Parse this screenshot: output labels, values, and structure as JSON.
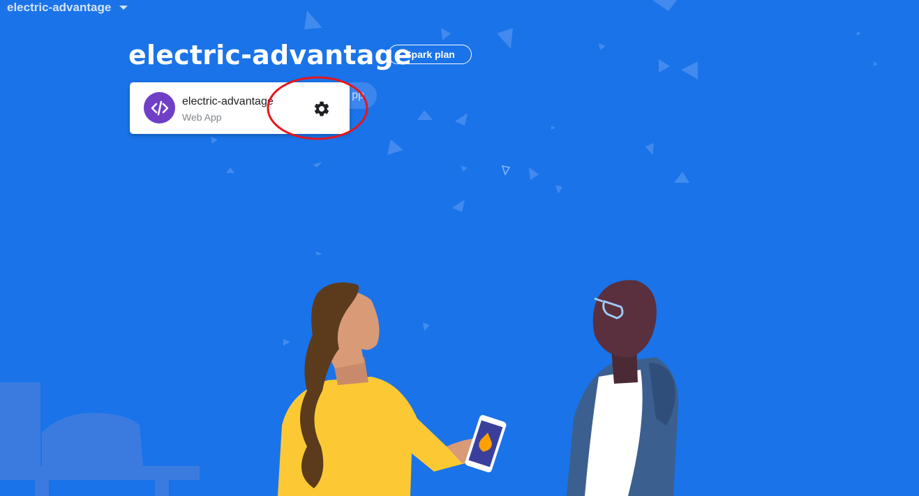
{
  "header": {
    "project_switcher_label": "electric-advantage",
    "project_title": "electric-advantage",
    "plan_badge": "Spark plan",
    "add_app_partial": "pp"
  },
  "apps": [
    {
      "name": "electric-advantage",
      "type": "Web App",
      "icon": "code-brackets-icon"
    }
  ],
  "colors": {
    "background": "#1a73e8",
    "app_icon_bg": "#6f3fc6",
    "highlight": "#e8141b"
  },
  "icons": [
    "dropdown-caret-icon",
    "code-brackets-icon",
    "gear-icon"
  ]
}
